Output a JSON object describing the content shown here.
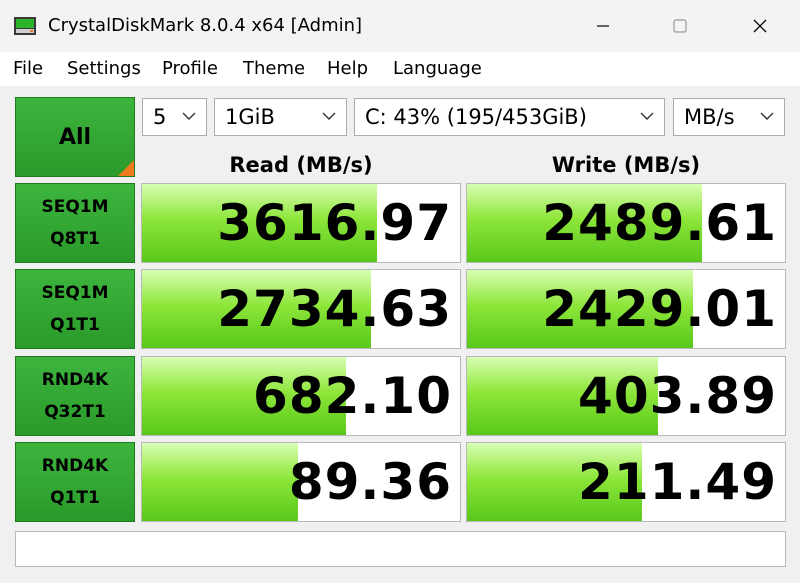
{
  "window": {
    "title": "CrystalDiskMark 8.0.4 x64 [Admin]"
  },
  "menu": [
    {
      "label": "File"
    },
    {
      "label": "Settings"
    },
    {
      "label": "Profile"
    },
    {
      "label": "Theme"
    },
    {
      "label": "Help"
    },
    {
      "label": "Language"
    }
  ],
  "controls": {
    "all_label": "All",
    "count": "5",
    "size": "1GiB",
    "drive": "C: 43% (195/453GiB)",
    "unit": "MB/s"
  },
  "columns": {
    "read": "Read (MB/s)",
    "write": "Write (MB/s)"
  },
  "tests": [
    {
      "line1": "SEQ1M",
      "line2": "Q8T1",
      "read": "3616.97",
      "write": "2489.61",
      "read_level": 0.74,
      "write_level": 0.74
    },
    {
      "line1": "SEQ1M",
      "line2": "Q1T1",
      "read": "2734.63",
      "write": "2429.01",
      "read_level": 0.72,
      "write_level": 0.71
    },
    {
      "line1": "RND4K",
      "line2": "Q32T1",
      "read": "682.10",
      "write": "403.89",
      "read_level": 0.64,
      "write_level": 0.6
    },
    {
      "line1": "RND4K",
      "line2": "Q1T1",
      "read": "89.36",
      "write": "211.49",
      "read_level": 0.49,
      "write_level": 0.55
    }
  ],
  "comment": "",
  "colors": {
    "accent_green": "#2a9a2a",
    "bar_green": "#58c81a",
    "corner_orange": "#f07b1f"
  }
}
